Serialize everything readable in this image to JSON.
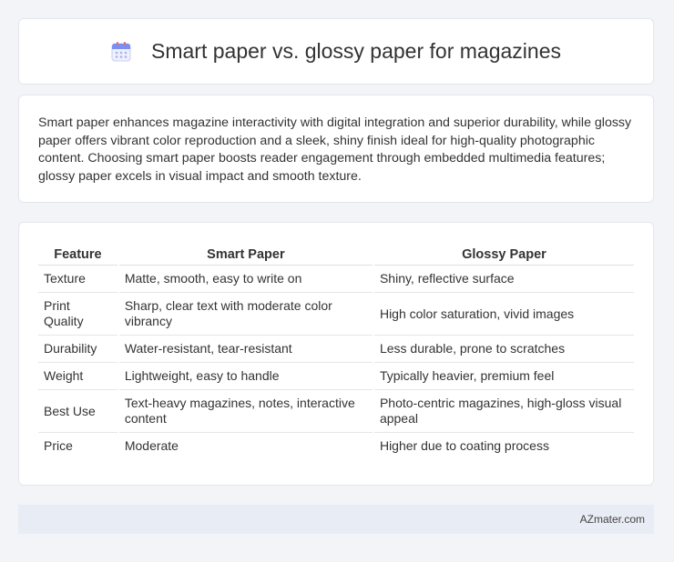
{
  "header": {
    "icon": "calendar-icon",
    "title": "Smart paper vs. glossy paper for magazines"
  },
  "description": "Smart paper enhances magazine interactivity with digital integration and superior durability, while glossy paper offers vibrant color reproduction and a sleek, shiny finish ideal for high-quality photographic content. Choosing smart paper boosts reader engagement through embedded multimedia features; glossy paper excels in visual impact and smooth texture.",
  "table": {
    "headers": [
      "Feature",
      "Smart Paper",
      "Glossy Paper"
    ],
    "rows": [
      [
        "Texture",
        "Matte, smooth, easy to write on",
        "Shiny, reflective surface"
      ],
      [
        "Print Quality",
        "Sharp, clear text with moderate color vibrancy",
        "High color saturation, vivid images"
      ],
      [
        "Durability",
        "Water-resistant, tear-resistant",
        "Less durable, prone to scratches"
      ],
      [
        "Weight",
        "Lightweight, easy to handle",
        "Typically heavier, premium feel"
      ],
      [
        "Best Use",
        "Text-heavy magazines, notes, interactive content",
        "Photo-centric magazines, high-gloss visual appeal"
      ],
      [
        "Price",
        "Moderate",
        "Higher due to coating process"
      ]
    ]
  },
  "footer": {
    "site": "AZmater.com"
  },
  "colors": {
    "background": "#f3f4f8",
    "card": "#ffffff",
    "footer_bg": "#e8ecf5",
    "icon_accent": "#7b8ff0"
  }
}
